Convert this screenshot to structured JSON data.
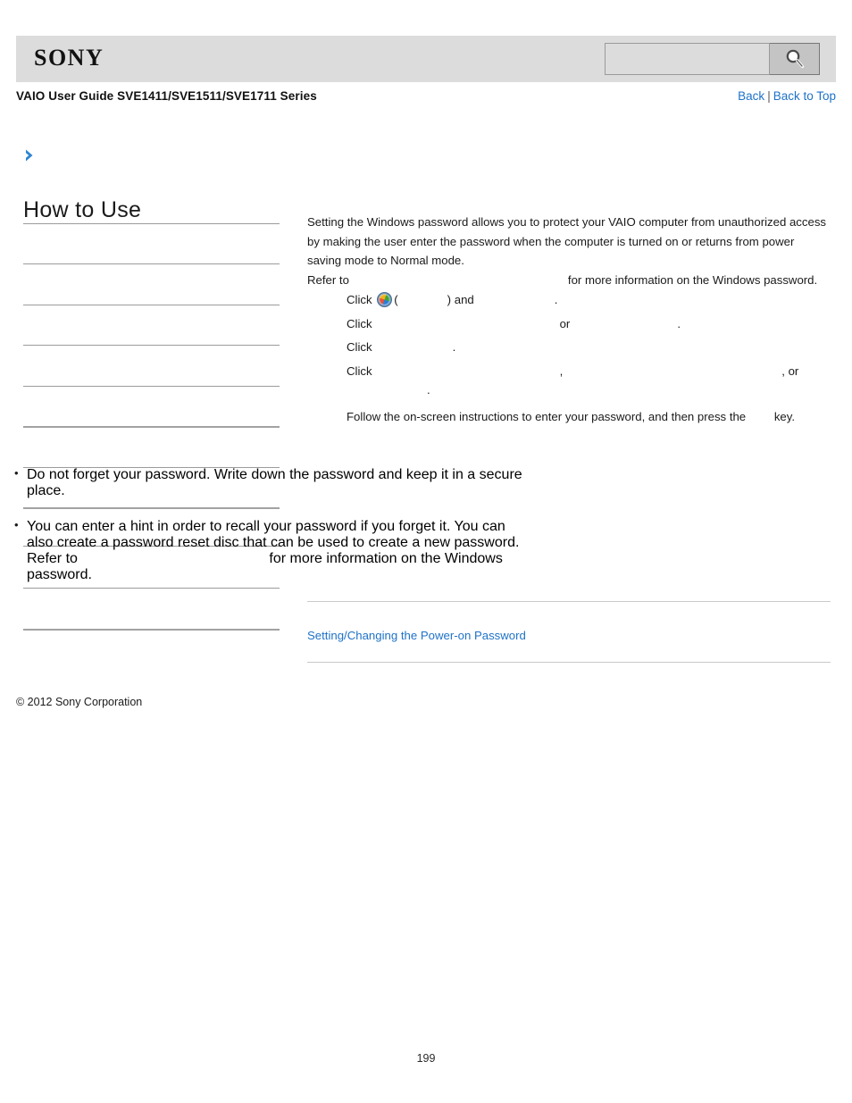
{
  "header": {
    "logo_text": "SONY",
    "search": {
      "value": "",
      "placeholder": "",
      "icon": "search-icon"
    }
  },
  "subheader": {
    "document_title": "VAIO User Guide SVE1411/SVE1511/SVE1711 Series",
    "nav": {
      "back_label": "Back",
      "separator": "|",
      "back_to_top_label": "Back to Top"
    }
  },
  "sidebar": {
    "breadcrumb_icon": "chevron-right-icon",
    "title": "How to Use",
    "items": [
      {
        "label": ""
      },
      {
        "label": ""
      },
      {
        "label": ""
      },
      {
        "label": ""
      },
      {
        "label": ""
      },
      {
        "label": ""
      },
      {
        "label": ""
      },
      {
        "label": ""
      },
      {
        "label": ""
      },
      {
        "label": ""
      },
      {
        "label": ""
      }
    ]
  },
  "content": {
    "intro_paragraph": "Setting the Windows password allows you to protect your VAIO computer from unauthorized access by making the user enter the password when the computer is turned on or returns from power saving mode to Normal mode.",
    "refer_prefix": "Refer to",
    "refer_target": "",
    "refer_suffix": "for more information on the Windows password.",
    "steps": [
      {
        "click_label": "Click",
        "orb_icon": "windows-start-orb-icon",
        "paren_open": "(",
        "orb_name": "",
        "paren_close": ")",
        "and_label": "and",
        "target": "",
        "period": "."
      },
      {
        "click_label": "Click",
        "target_a": "",
        "or_label": "or",
        "target_b": "",
        "period": "."
      },
      {
        "click_label": "Click",
        "target": "",
        "period": "."
      },
      {
        "click_label": "Click",
        "target_a": "",
        "comma_a": ",",
        "target_b": "",
        "comma_b": ", or",
        "target_c": "",
        "period": "."
      },
      {
        "text_before": "Follow the on-screen instructions to enter your password, and then press the",
        "key_name": "",
        "text_after": "key."
      }
    ],
    "notes": [
      {
        "text": "Do not forget your password. Write down the password and keep it in a secure place."
      },
      {
        "text_a": "You can enter a hint in order to recall your password if you forget it. You can also create a password reset disc that can be used to create a new password. Refer to",
        "ref": "",
        "text_b": "for more information on the Windows password."
      }
    ],
    "related_link": "Setting/Changing the Power-on Password"
  },
  "footer": {
    "copyright": "© 2012 Sony Corporation",
    "page_number": "199"
  },
  "colors": {
    "link": "#1f72c8",
    "header_bg": "#dcdcdc",
    "rule": "#9b9b9b"
  }
}
